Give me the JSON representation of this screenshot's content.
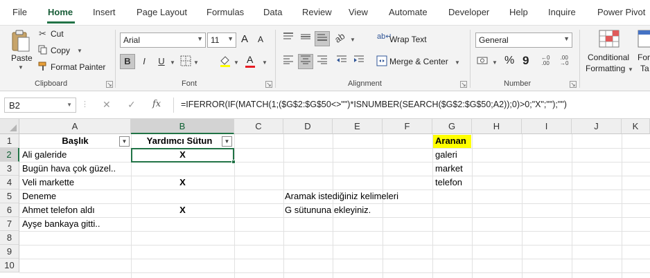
{
  "menu": {
    "tabs": [
      {
        "label": "File",
        "active": false
      },
      {
        "label": "Home",
        "active": true
      },
      {
        "label": "Insert",
        "active": false
      },
      {
        "label": "Page Layout",
        "active": false
      },
      {
        "label": "Formulas",
        "active": false
      },
      {
        "label": "Data",
        "active": false
      },
      {
        "label": "Review",
        "active": false
      },
      {
        "label": "View",
        "active": false
      },
      {
        "label": "Automate",
        "active": false
      },
      {
        "label": "Developer",
        "active": false
      },
      {
        "label": "Help",
        "active": false
      },
      {
        "label": "Inquire",
        "active": false
      },
      {
        "label": "Power Pivot",
        "active": false
      }
    ]
  },
  "ribbon": {
    "clipboard": {
      "paste": "Paste",
      "cut": "Cut",
      "copy": "Copy",
      "format_painter": "Format Painter",
      "group_label": "Clipboard"
    },
    "font": {
      "font_name": "Arial",
      "font_size": "11",
      "bold": "B",
      "italic": "I",
      "underline": "U",
      "font_color_letter": "A",
      "grow_letter": "A",
      "shrink_letter": "A",
      "group_label": "Font"
    },
    "alignment": {
      "wrap_text": "Wrap Text",
      "merge_center": "Merge & Center",
      "group_label": "Alignment"
    },
    "number": {
      "format": "General",
      "percent": "%",
      "comma": "9",
      "group_label": "Number"
    },
    "styles": {
      "conditional_formatting_line1": "Conditional",
      "conditional_formatting_line2": "Formatting",
      "format_as_table_line1": "For",
      "format_as_table_line2": "Ta"
    }
  },
  "formula_bar": {
    "name_box": "B2",
    "fx": "fx",
    "formula": "=IFERROR(IF(MATCH(1;($G$2:$G$50<>\"\")*ISNUMBER(SEARCH($G$2:$G$50;A2));0)>0;\"X\";\"\");\"\")"
  },
  "grid": {
    "columns": [
      "A",
      "B",
      "C",
      "D",
      "E",
      "F",
      "G",
      "H",
      "I",
      "J",
      "K"
    ],
    "rows": [
      "1",
      "2",
      "3",
      "4",
      "5",
      "6",
      "7",
      "8",
      "9",
      "10"
    ],
    "cells": {
      "A1": "Başlık",
      "B1": "Yardımcı Sütun",
      "G1": "Aranan",
      "A2": "Ali galeride",
      "B2": "X",
      "G2": "galeri",
      "A3": "Bugün hava çok güzel..",
      "G3": "market",
      "A4": "Veli markette",
      "B4": "X",
      "G4": "telefon",
      "A5": "Deneme",
      "D5": "Aramak istediğiniz kelimeleri",
      "A6": "Ahmet telefon aldı",
      "B6": "X",
      "D6": "G sütununa ekleyiniz.",
      "A7": "Ayşe bankaya gitti.."
    },
    "selected_cell": "B2",
    "highlight_color": "#ffff00",
    "selection_color": "#217346"
  },
  "colors": {
    "accent": "#217346",
    "ribbon_bg": "#f3f3f3"
  }
}
